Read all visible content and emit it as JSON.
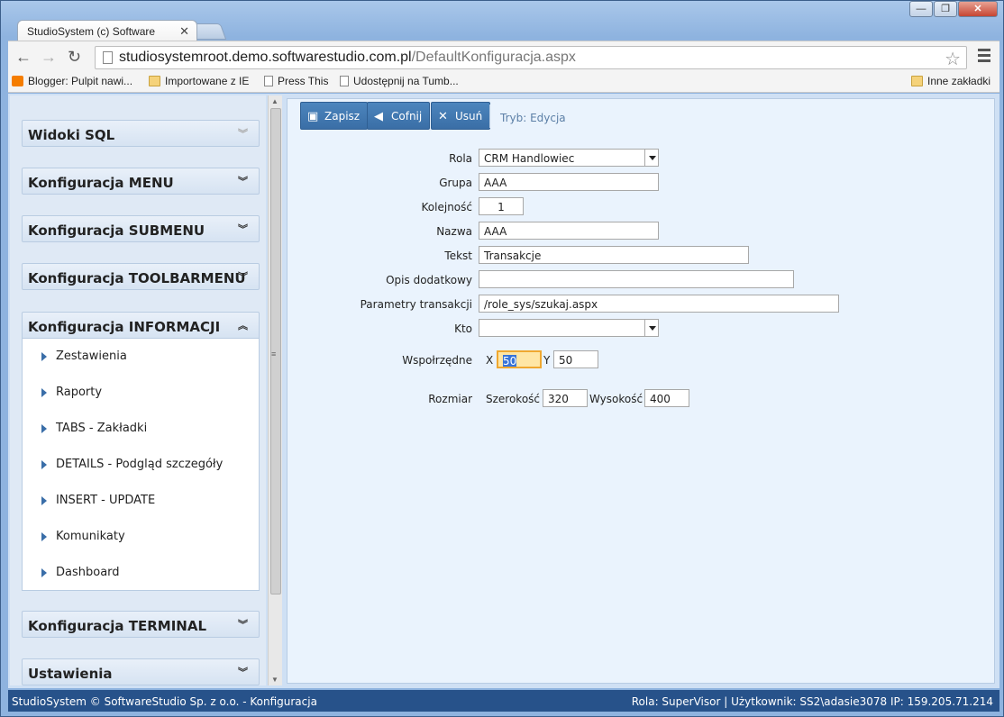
{
  "browser": {
    "tab_title": "StudioSystem (c) Software",
    "url_host": "studiosystemroot.demo.softwarestudio.com.pl",
    "url_path": "/DefaultKonfiguracja.aspx",
    "window_buttons": {
      "minimize": "—",
      "maximize": "❐",
      "close": "✕"
    }
  },
  "bookmarks": [
    {
      "label": "Blogger: Pulpit nawi...",
      "icon": "blogger-icon"
    },
    {
      "label": "Importowane z IE",
      "icon": "folder-icon"
    },
    {
      "label": "Press This",
      "icon": "page-icon"
    },
    {
      "label": "Udostępnij na Tumb...",
      "icon": "page-icon"
    },
    {
      "label": "Inne zakładki",
      "icon": "folder-icon"
    }
  ],
  "sidebar": {
    "sections": [
      {
        "title": "Widoki SQL"
      },
      {
        "title": "Konfiguracja MENU"
      },
      {
        "title": "Konfiguracja SUBMENU"
      },
      {
        "title": "Konfiguracja TOOLBARMENU"
      },
      {
        "title": "Konfiguracja INFORMACJI"
      },
      {
        "title": "Konfiguracja TERMINAL"
      },
      {
        "title": "Ustawienia"
      }
    ],
    "items": [
      "Zestawienia",
      "Raporty",
      "TABS - Zakładki",
      "DETAILS - Podgląd szczegóły",
      "INSERT - UPDATE",
      "Komunikaty",
      "Dashboard"
    ]
  },
  "toolbar": {
    "save": "Zapisz",
    "back": "Cofnij",
    "delete": "Usuń",
    "mode": "Tryb: Edycja"
  },
  "form": {
    "rola_label": "Rola",
    "rola_value": "CRM Handlowiec",
    "grupa_label": "Grupa",
    "grupa_value": "AAA",
    "kolejnosc_label": "Kolejność",
    "kolejnosc_value": "1",
    "nazwa_label": "Nazwa",
    "nazwa_value": "AAA",
    "tekst_label": "Tekst",
    "tekst_value": "Transakcje",
    "opis_label": "Opis dodatkowy",
    "opis_value": "",
    "param_label": "Parametry transakcji",
    "param_value": "/role_sys/szukaj.aspx",
    "kto_label": "Kto",
    "kto_value": "",
    "wsp_label": "Wspołrzędne",
    "x_label": "X",
    "x_value": "50",
    "y_label": "Y",
    "y_value": "50",
    "rozmiar_label": "Rozmiar",
    "szer_label": "Szerokość",
    "szer_value": "320",
    "wys_label": "Wysokość",
    "wys_value": "400"
  },
  "status": {
    "left": "StudioSystem © SoftwareStudio Sp. z o.o. - Konfiguracja",
    "right": "Rola: SuperVisor | Użytkownik: SS2\\adasie3078 IP: 159.205.71.214"
  }
}
